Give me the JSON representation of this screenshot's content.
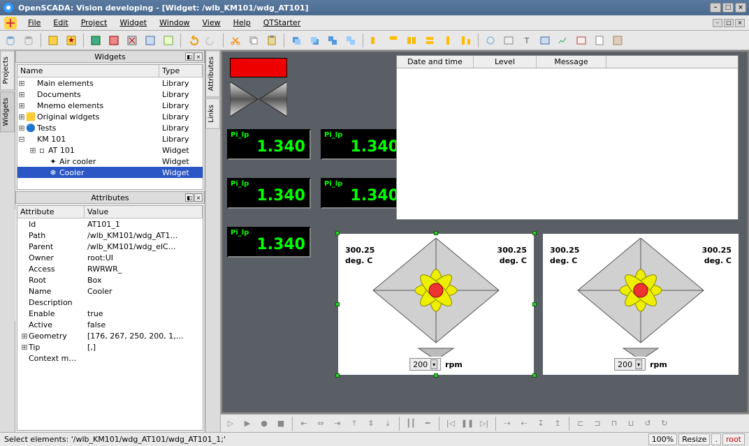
{
  "title": "OpenSCADA: Vision developing - [Widget: /wlb_KM101/wdg_AT101]",
  "menu": {
    "file": "File",
    "edit": "Edit",
    "project": "Project",
    "widget": "Widget",
    "window": "Window",
    "view": "View",
    "help": "Help",
    "qtstarter": "QTStarter"
  },
  "sidetabs": {
    "projects": "Projects",
    "widgets": "Widgets",
    "attributes": "Attributes",
    "links": "Links"
  },
  "widgetsPanel": {
    "title": "Widgets",
    "col1": "Name",
    "col2": "Type",
    "items": [
      {
        "indent": 0,
        "exp": "⊞",
        "name": "Main elements",
        "type": "Library"
      },
      {
        "indent": 0,
        "exp": "⊞",
        "name": "Documents",
        "type": "Library"
      },
      {
        "indent": 0,
        "exp": "⊞",
        "name": "Mnemo elements",
        "type": "Library"
      },
      {
        "indent": 0,
        "exp": "⊞",
        "icon": "orig",
        "name": "Original widgets",
        "type": "Library"
      },
      {
        "indent": 0,
        "exp": "⊞",
        "icon": "tests",
        "name": "Tests",
        "type": "Library"
      },
      {
        "indent": 0,
        "exp": "⊟",
        "name": "KM 101",
        "type": "Library"
      },
      {
        "indent": 1,
        "exp": "⊞",
        "icon": "wdg",
        "name": "AT 101",
        "type": "Widget"
      },
      {
        "indent": 2,
        "exp": "",
        "icon": "air",
        "name": "Air cooler",
        "type": "Widget"
      },
      {
        "indent": 2,
        "exp": "",
        "icon": "cool",
        "selected": true,
        "name": "Cooler",
        "type": "Widget"
      }
    ]
  },
  "attrPanel": {
    "title": "Attributes",
    "col1": "Attribute",
    "col2": "Value",
    "rows": [
      {
        "a": "Id",
        "v": "AT101_1"
      },
      {
        "a": "Path",
        "v": "/wlb_KM101/wdg_AT1…"
      },
      {
        "a": "Parent",
        "v": "/wlb_KM101/wdg_elC…"
      },
      {
        "a": "Owner",
        "v": "root:UI"
      },
      {
        "a": "Access",
        "v": "RWRWR_"
      },
      {
        "a": "Root",
        "v": "Box"
      },
      {
        "a": "Name",
        "v": "Cooler"
      },
      {
        "a": "Description",
        "v": ""
      },
      {
        "a": "Enable",
        "v": "true"
      },
      {
        "a": "Active",
        "v": "false"
      },
      {
        "a": "Geometry",
        "v": "[176, 267, 250, 200, 1,…",
        "exp": "⊞"
      },
      {
        "a": "Tip",
        "v": "[,]",
        "exp": "⊞"
      },
      {
        "a": "Context m…",
        "v": ""
      }
    ]
  },
  "canvas": {
    "pilp_label": "Pi_lp",
    "pilp_value": "1.340",
    "msgcols": {
      "dt": "Date and time",
      "level": "Level",
      "msg": "Message"
    },
    "cooler": {
      "temp": "300.25",
      "unit": "deg. C",
      "rpm_val": "200",
      "rpm_unit": "rpm"
    }
  },
  "status": {
    "text": "Select elements: '/wlb_KM101/wdg_AT101/wdg_AT101_1;'",
    "zoom": "100%",
    "resize": "Resize",
    "dots": ".",
    "user": "root"
  }
}
